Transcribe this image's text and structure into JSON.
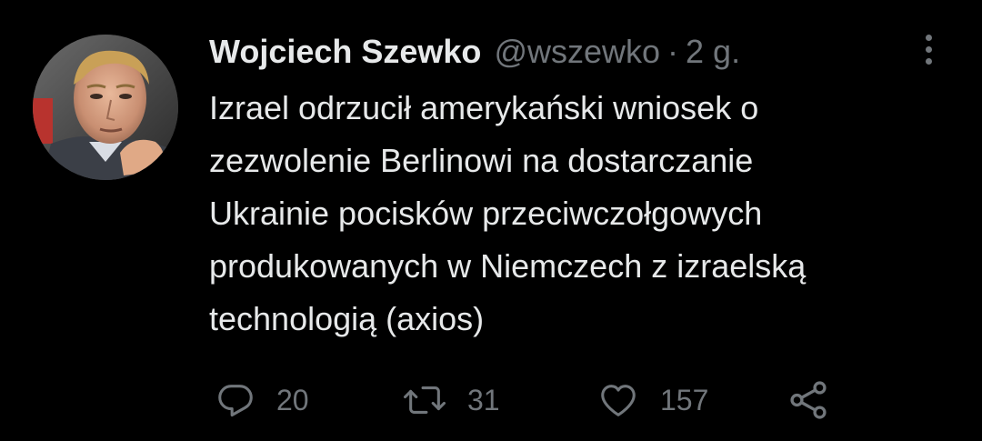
{
  "tweet": {
    "author": {
      "display_name": "Wojciech Szewko",
      "handle": "@wszewko",
      "avatar_icon": "profile-photo"
    },
    "separator": "·",
    "time": "2 g.",
    "more_icon": "more-vertical-icon",
    "text": "Izrael odrzucił amerykański wniosek o\nzezwolenie Berlinowi na dostarczanie\nUkrainie pocisków przeciwczołgowych\nprodukowanych w Niemczech z izraelską\ntechnologią (axios)",
    "actions": {
      "reply": {
        "icon": "reply-icon",
        "count": "20"
      },
      "retweet": {
        "icon": "retweet-icon",
        "count": "31"
      },
      "like": {
        "icon": "heart-icon",
        "count": "157"
      },
      "share": {
        "icon": "share-icon"
      }
    }
  },
  "colors": {
    "background": "#000000",
    "text_primary": "#e7e9ea",
    "text_secondary": "#71767b"
  }
}
